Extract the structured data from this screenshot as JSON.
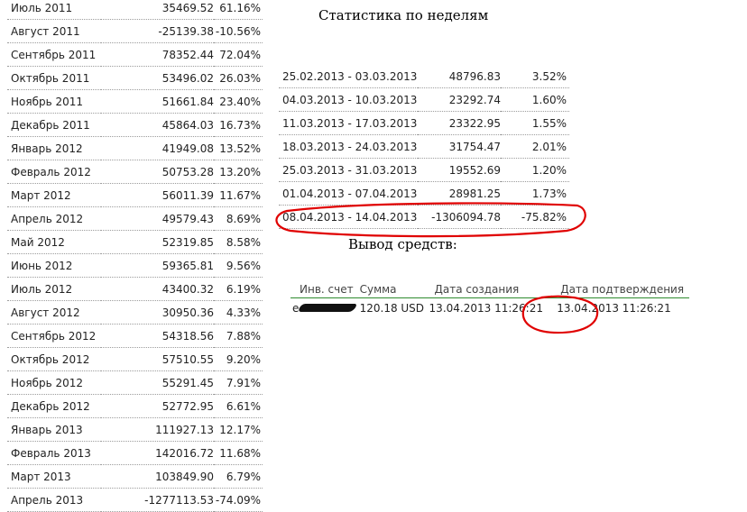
{
  "monthly": [
    {
      "period": "Июль 2011",
      "amount": "35469.52",
      "percent": "61.16%"
    },
    {
      "period": "Август 2011",
      "amount": "-25139.38",
      "percent": "-10.56%"
    },
    {
      "period": "Сентябрь 2011",
      "amount": "78352.44",
      "percent": "72.04%"
    },
    {
      "period": "Октябрь 2011",
      "amount": "53496.02",
      "percent": "26.03%"
    },
    {
      "period": "Ноябрь 2011",
      "amount": "51661.84",
      "percent": "23.40%"
    },
    {
      "period": "Декабрь 2011",
      "amount": "45864.03",
      "percent": "16.73%"
    },
    {
      "period": "Январь 2012",
      "amount": "41949.08",
      "percent": "13.52%"
    },
    {
      "period": "Февраль 2012",
      "amount": "50753.28",
      "percent": "13.20%"
    },
    {
      "period": "Март 2012",
      "amount": "56011.39",
      "percent": "11.67%"
    },
    {
      "period": "Апрель 2012",
      "amount": "49579.43",
      "percent": "8.69%"
    },
    {
      "period": "Май 2012",
      "amount": "52319.85",
      "percent": "8.58%"
    },
    {
      "period": "Июнь 2012",
      "amount": "59365.81",
      "percent": "9.56%"
    },
    {
      "period": "Июль 2012",
      "amount": "43400.32",
      "percent": "6.19%"
    },
    {
      "period": "Август 2012",
      "amount": "30950.36",
      "percent": "4.33%"
    },
    {
      "period": "Сентябрь 2012",
      "amount": "54318.56",
      "percent": "7.88%"
    },
    {
      "period": "Октябрь 2012",
      "amount": "57510.55",
      "percent": "9.20%"
    },
    {
      "period": "Ноябрь 2012",
      "amount": "55291.45",
      "percent": "7.91%"
    },
    {
      "period": "Декабрь 2012",
      "amount": "52772.95",
      "percent": "6.61%"
    },
    {
      "period": "Январь 2013",
      "amount": "111927.13",
      "percent": "12.17%"
    },
    {
      "period": "Февраль 2013",
      "amount": "142016.72",
      "percent": "11.68%"
    },
    {
      "period": "Март 2013",
      "amount": "103849.90",
      "percent": "6.79%"
    },
    {
      "period": "Апрель 2013",
      "amount": "-1277113.53",
      "percent": "-74.09%"
    }
  ],
  "weekly": {
    "title": "Статистика по неделям",
    "rows": [
      {
        "period": "25.02.2013 - 03.03.2013",
        "amount": "48796.83",
        "percent": "3.52%"
      },
      {
        "period": "04.03.2013 - 10.03.2013",
        "amount": "23292.74",
        "percent": "1.60%"
      },
      {
        "period": "11.03.2013 - 17.03.2013",
        "amount": "23322.95",
        "percent": "1.55%"
      },
      {
        "period": "18.03.2013 - 24.03.2013",
        "amount": "31754.47",
        "percent": "2.01%"
      },
      {
        "period": "25.03.2013 - 31.03.2013",
        "amount": "19552.69",
        "percent": "1.20%"
      },
      {
        "period": "01.04.2013 - 07.04.2013",
        "amount": "28981.25",
        "percent": "1.73%"
      },
      {
        "period": "08.04.2013 - 14.04.2013",
        "amount": "-1306094.78",
        "percent": "-75.82%"
      }
    ]
  },
  "withdrawal": {
    "title": "Вывод средств:",
    "headers": {
      "account": "Инв. счет",
      "sum": "Сумма",
      "created": "Дата создания",
      "confirmed": "Дата подтверждения"
    },
    "row": {
      "account_visible": "е",
      "sum": "120.18 USD",
      "created": "13.04.2013 11:26:21",
      "confirmed": "13.04.2013 11:26:21"
    }
  },
  "colors": {
    "annotation": "#e00000",
    "header_rule": "#2e8b2e",
    "dotted_rule": "#9c9c9c"
  }
}
